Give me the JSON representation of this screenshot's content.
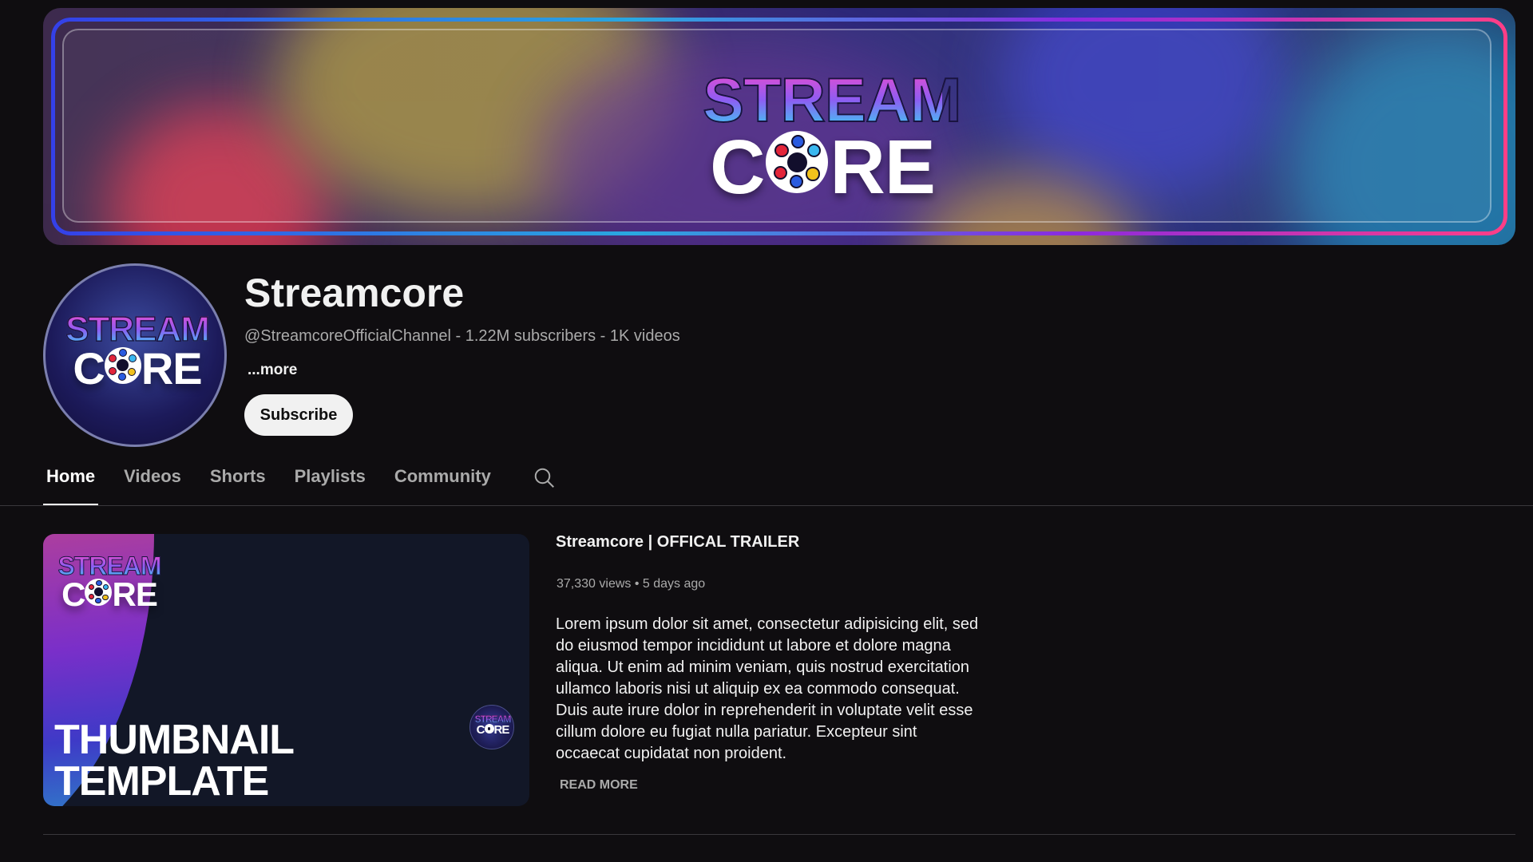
{
  "banner": {
    "logo_top": "STREAM",
    "logo_bottom_left": "C",
    "logo_bottom_right": "RE"
  },
  "channel": {
    "avatar_logo_top": "STREAM",
    "avatar_logo_left": "C",
    "avatar_logo_right": "RE",
    "name": "Streamcore",
    "meta": "@StreamcoreOfficialChannel - 1.22M subscribers - 1K videos",
    "more_label": "...more",
    "subscribe_label": "Subscribe"
  },
  "tabs": [
    {
      "label": "Home",
      "active": true
    },
    {
      "label": "Videos",
      "active": false
    },
    {
      "label": "Shorts",
      "active": false
    },
    {
      "label": "Playlists",
      "active": false
    },
    {
      "label": "Community",
      "active": false
    }
  ],
  "tabs_search_icon": "search-icon",
  "featured": {
    "thumb_logo_top": "STREAM",
    "thumb_logo_left": "C",
    "thumb_logo_right": "RE",
    "thumb_title_line1": "THUMBNAIL",
    "thumb_title_line2": "TEMPLATE",
    "badge_logo_top": "STREAM",
    "badge_logo_left": "C",
    "badge_logo_right": "RE",
    "title": "Streamcore | OFFICAL TRAILER",
    "meta": "37,330 views • 5 days ago",
    "description": "Lorem ipsum dolor sit amet, consectetur adipisicing elit, sed do eiusmod tempor incididunt ut labore et dolore magna aliqua. Ut enim ad minim veniam, quis nostrud exercitation ullamco laboris nisi ut aliquip ex ea commodo consequat. Duis aute irure dolor in reprehenderit in voluptate velit esse cillum dolore eu fugiat nulla pariatur. Excepteur sint occaecat cupidatat non proident.",
    "read_more_label": "READ MORE"
  },
  "colors": {
    "background": "#0f0d10",
    "text_primary": "#f1f1f1",
    "text_secondary": "#aaaaaa",
    "reel_dot_red": "#e2253a",
    "reel_dot_blue": "#2a5be0",
    "reel_dot_yellow": "#f2c21c",
    "reel_dot_cyan": "#3ab8f0"
  }
}
